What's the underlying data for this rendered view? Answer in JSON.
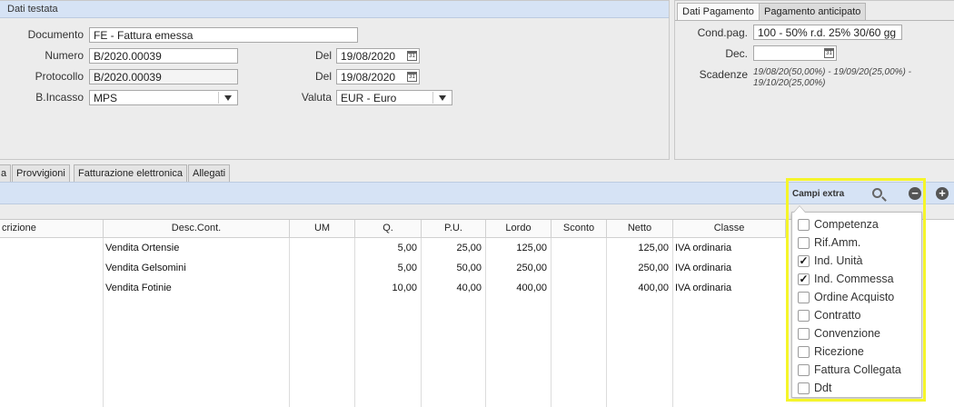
{
  "header": {
    "title": "Dati testata",
    "documento_label": "Documento",
    "documento_value": "FE - Fattura emessa",
    "numero_label": "Numero",
    "numero_value": "B/2020.00039",
    "del_label": "Del",
    "numero_date": "19/08/2020",
    "protocollo_label": "Protocollo",
    "protocollo_value": "B/2020.00039",
    "protocollo_date": "19/08/2020",
    "incasso_label": "B.Incasso",
    "incasso_value": "MPS",
    "valuta_label": "Valuta",
    "valuta_value": "EUR - Euro",
    "calendar_glyph": "31"
  },
  "payment": {
    "tabs": [
      "Dati Pagamento",
      "Pagamento anticipato"
    ],
    "cond_label": "Cond.pag.",
    "cond_value": "100 - 50% r.d. 25% 30/60 gg",
    "dec_label": "Dec.",
    "dec_value": "",
    "scadenze_label": "Scadenze",
    "scadenze_value": "19/08/20(50,00%) - 19/09/20(25,00%) - 19/10/20(25,00%)"
  },
  "tabs": [
    "a",
    "Provvigioni",
    "Fatturazione elettronica",
    "Allegati"
  ],
  "grid": {
    "columns": [
      "crizione",
      "Desc.Cont.",
      "UM",
      "Q.",
      "P.U.",
      "Lordo",
      "Sconto",
      "Netto",
      "Classe"
    ],
    "rows": [
      {
        "desc": "Vendita Ortensie",
        "um": "",
        "q": "5,00",
        "pu": "25,00",
        "lordo": "125,00",
        "sconto": "",
        "netto": "125,00",
        "classe": "IVA ordinaria"
      },
      {
        "desc": "Vendita Gelsomini",
        "um": "",
        "q": "5,00",
        "pu": "50,00",
        "lordo": "250,00",
        "sconto": "",
        "netto": "250,00",
        "classe": "IVA ordinaria"
      },
      {
        "desc": "Vendita Fotinie",
        "um": "",
        "q": "10,00",
        "pu": "40,00",
        "lordo": "400,00",
        "sconto": "",
        "netto": "400,00",
        "classe": "IVA ordinaria"
      }
    ]
  },
  "extra": {
    "title": "Campi extra",
    "minus": "−",
    "plus": "+",
    "check_mark": "✓",
    "options": [
      {
        "label": "Competenza",
        "checked": false
      },
      {
        "label": "Rif.Amm.",
        "checked": false
      },
      {
        "label": "Ind. Unità",
        "checked": true
      },
      {
        "label": "Ind. Commessa",
        "checked": true
      },
      {
        "label": "Ordine Acquisto",
        "checked": false
      },
      {
        "label": "Contratto",
        "checked": false
      },
      {
        "label": "Convenzione",
        "checked": false
      },
      {
        "label": "Ricezione",
        "checked": false
      },
      {
        "label": "Fattura Collegata",
        "checked": false
      },
      {
        "label": "Ddt",
        "checked": false
      }
    ],
    "highlight_color": "#f5f52a"
  }
}
